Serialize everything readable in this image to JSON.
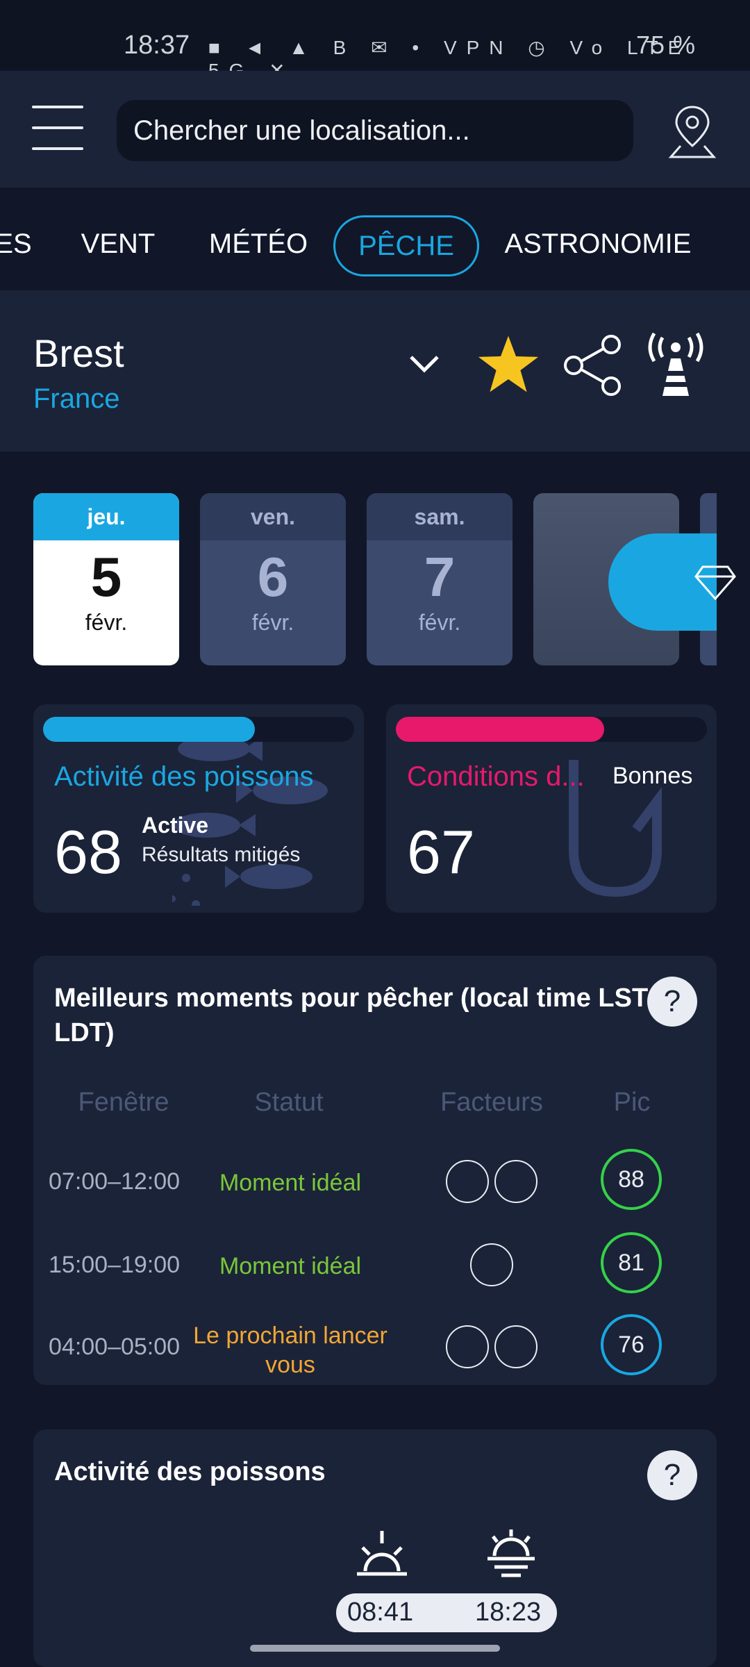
{
  "status_bar": {
    "time": "18:37",
    "icons_text": "■ ◄ ▲ B ✉ • VPN ◷ Vo LTE 5G ✕",
    "battery": "75 %"
  },
  "header": {
    "search_placeholder": "Chercher une localisation..."
  },
  "tabs": [
    {
      "label": "ES"
    },
    {
      "label": "VENT"
    },
    {
      "label": "MÉTÉO"
    },
    {
      "label": "PÊCHE"
    },
    {
      "label": "ASTRONOMIE"
    }
  ],
  "location": {
    "city": "Brest",
    "country": "France"
  },
  "days": [
    {
      "dow": "jeu.",
      "num": "5",
      "mon": "févr."
    },
    {
      "dow": "ven.",
      "num": "6",
      "mon": "févr."
    },
    {
      "dow": "sam.",
      "num": "7",
      "mon": "févr."
    }
  ],
  "fish_activity_card": {
    "label": "Activité des poissons",
    "score": "68",
    "level": "Active",
    "note": "Résultats mitigés",
    "progress": 0.68,
    "color": "#1aa7e1"
  },
  "conditions_card": {
    "label": "Conditions d...",
    "rating": "Bonnes",
    "score": "67",
    "progress": 0.67,
    "color": "#e8196b"
  },
  "best_times": {
    "title": "Meilleurs moments pour pêcher (local time LST LDT)",
    "help": "?",
    "headers": {
      "window": "Fenêtre",
      "status": "Statut",
      "factors": "Facteurs",
      "peak": "Pic"
    },
    "rows": [
      {
        "window": "07:00–12:00",
        "status": "Moment idéal",
        "status_color": "#7ac73a",
        "peak": "88",
        "ring_color": "#35d14a"
      },
      {
        "window": "15:00–19:00",
        "status": "Moment idéal",
        "status_color": "#7ac73a",
        "peak": "81",
        "ring_color": "#35d14a"
      },
      {
        "window": "04:00–05:00",
        "status": "Le prochain lancer vous",
        "status_color": "#f2a634",
        "peak": "76",
        "ring_color": "#1aa7e1"
      }
    ]
  },
  "activity": {
    "title": "Activité des poissons",
    "help": "?",
    "sunrise": "08:41",
    "sunset": "18:23"
  }
}
